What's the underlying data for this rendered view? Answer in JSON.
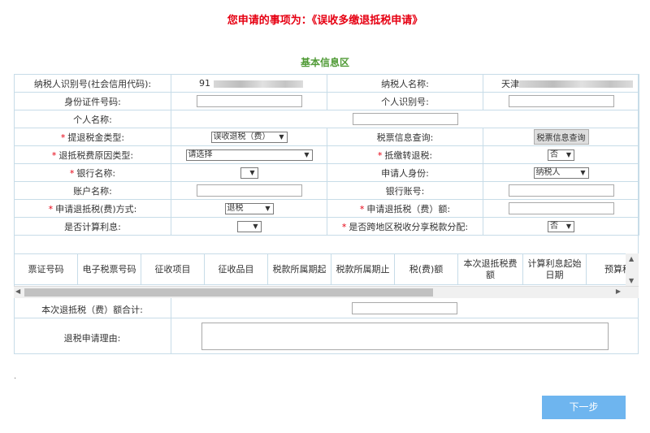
{
  "page_title": "您申请的事项为：《误收多缴退抵税申请》",
  "section_title": "基本信息区",
  "rows": {
    "taxpayer_id_label": "纳税人识别号(社会信用代码):",
    "taxpayer_id_value_prefix": "91",
    "taxpayer_name_label": "纳税人名称:",
    "taxpayer_name_value_prefix": "天津",
    "id_doc_label": "身份证件号码:",
    "personal_id_label": "个人识别号:",
    "personal_name_label": "个人名称:",
    "refund_type_label": "提退税金类型:",
    "refund_type_value": "误收退税（费）",
    "invoice_query_label": "税票信息查询:",
    "invoice_query_button": "税票信息查询",
    "reason_type_label": "退抵税费原因类型:",
    "reason_type_value": "请选择",
    "offset_label": "抵缴转退税:",
    "offset_value": "否",
    "bank_name_label": "银行名称:",
    "applicant_identity_label": "申请人身份:",
    "applicant_identity_value": "纳税人",
    "account_name_label": "账户名称:",
    "bank_account_label": "银行账号:",
    "refund_method_label": "申请退抵税(费)方式:",
    "refund_method_value": "退税",
    "refund_amount_label": "申请退抵税（费）额:",
    "interest_label": "是否计算利息:",
    "cross_region_label": "是否跨地区税收分享税款分配:",
    "cross_region_value": "否"
  },
  "grid": {
    "columns": [
      "票证号码",
      "电子税票号码",
      "征收项目",
      "征收品目",
      "税款所属期起",
      "税款所属期止",
      "税(费)额",
      "本次退抵税费额",
      "计算利息起始日期",
      "预算科"
    ]
  },
  "total_label": "本次退抵税（费）额合计:",
  "reason_label": "退税申请理由:",
  "dot_text": ".",
  "next_button": "下一步"
}
